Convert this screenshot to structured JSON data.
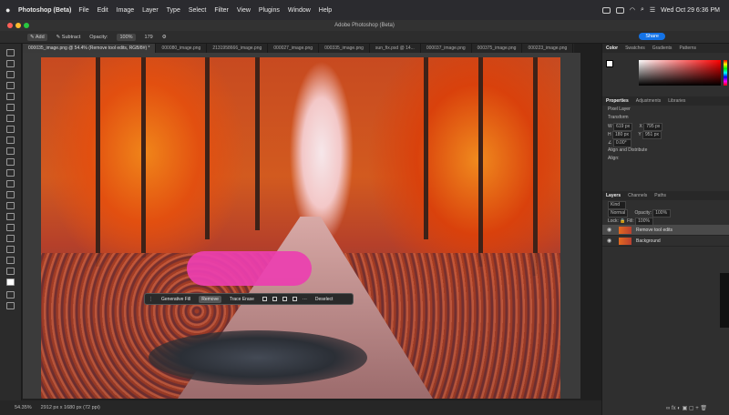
{
  "menubar": {
    "apple": "",
    "app": "Photoshop (Beta)",
    "items": [
      "File",
      "Edit",
      "Image",
      "Layer",
      "Type",
      "Select",
      "Filter",
      "View",
      "Plugins",
      "Window",
      "Help"
    ],
    "clock": "Wed Oct 29  6:36 PM"
  },
  "window": {
    "title": "Adobe Photoshop (Beta)"
  },
  "options": {
    "add_label": "Add",
    "subtract_label": "Subtract",
    "opacity_label": "Opacity:",
    "opacity_value": "100%",
    "brush_size": "179",
    "share_label": "Share"
  },
  "tabs": [
    "000035_image.png @ 54.4% (Remove tool edits, RGB/8#) *",
    "000080_image.png",
    "2131958666_image.png",
    "000027_image.png",
    "000335_image.png",
    "sun_fix.psd @ 14...",
    "000037_image.png",
    "000375_image.png",
    "000223_image.png"
  ],
  "taskbar": {
    "generative_fill": "Generative Fill",
    "remove": "Remove",
    "trace_erase": "Trace Erase",
    "more": "···",
    "deselect": "Deselect"
  },
  "status": {
    "zoom": "54.35%",
    "doc_size": "2912 px x 1680 px (72 ppi)"
  },
  "panels": {
    "color_tabs": [
      "Color",
      "Swatches",
      "Gradients",
      "Patterns"
    ],
    "props_tabs": [
      "Properties",
      "Adjustments",
      "Libraries"
    ],
    "pixel_layer": "Pixel Layer",
    "transform_label": "Transform",
    "w_label": "W",
    "w_value": "619 px",
    "h_label": "H",
    "h_value": "180 px",
    "x_label": "X",
    "x_value": "795 px",
    "y_label": "Y",
    "y_value": "951 px",
    "angle_value": "0.00°",
    "align_label": "Align and Distribute",
    "align_sub": "Align:",
    "layers_tabs": [
      "Layers",
      "Channels",
      "Paths"
    ],
    "kind_label": "Kind",
    "blend_mode": "Normal",
    "opacity_label": "Opacity:",
    "opacity_value": "100%",
    "lock_label": "Lock:",
    "fill_label": "Fill:",
    "fill_value": "100%",
    "layers": [
      "Remove tool edits",
      "Background"
    ],
    "bottom_icons": "∞  fx  ◐  ▣  ▢  +  🗑"
  },
  "colors": {
    "accent": "#1473e6",
    "mask": "#ec3fb0"
  }
}
